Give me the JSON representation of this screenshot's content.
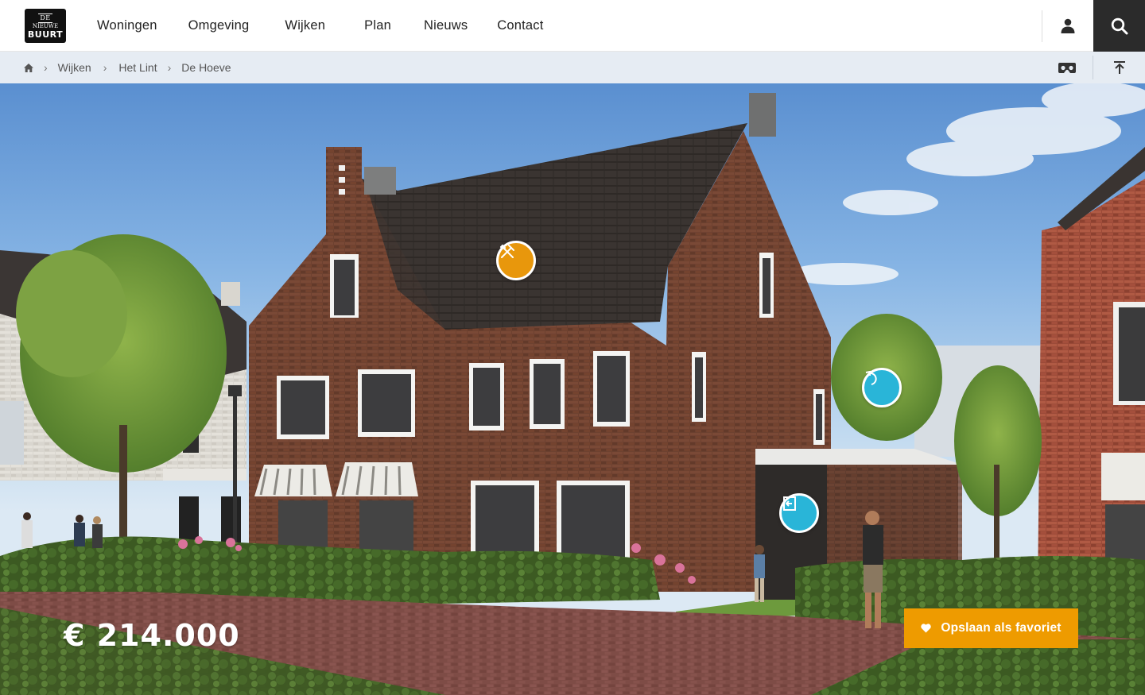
{
  "brand": {
    "logo_line1": "DE",
    "logo_line2": "NIEUWE",
    "logo_line3": "BUURT"
  },
  "nav": {
    "items": [
      "Woningen",
      "Omgeving",
      "Wijken",
      "Plan",
      "Nieuws",
      "Contact"
    ]
  },
  "header": {
    "user_icon": "user-icon",
    "search_icon": "search-icon"
  },
  "breadcrumb": {
    "home_icon": "home-icon",
    "items": [
      "Wijken",
      "Het Lint",
      "De Hoeve"
    ],
    "separator": "›"
  },
  "toolbar": {
    "vr_icon": "vr-headset-icon",
    "top_icon": "scroll-to-top-icon"
  },
  "hero": {
    "hotspots": [
      {
        "icon": "tools-icon",
        "color": "#e8970c"
      },
      {
        "icon": "rotate-icon",
        "color": "#29b5d8"
      },
      {
        "icon": "door-enter-icon",
        "color": "#29b5d8"
      }
    ],
    "price": "€ 214.000",
    "favorite_label": "Opslaan als favoriet",
    "favorite_color": "#ee9b00"
  }
}
